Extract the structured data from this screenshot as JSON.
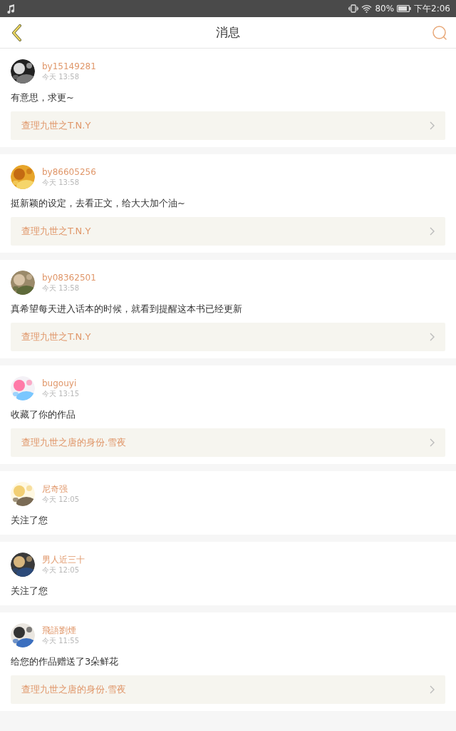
{
  "status_bar": {
    "battery": "80%",
    "time": "下午2:06"
  },
  "header": {
    "title": "消息"
  },
  "messages": [
    {
      "user": "by15149281",
      "time": "今天 13:58",
      "text": "有意思，求更~",
      "link": "查理九世之T.N.Y"
    },
    {
      "user": "by86605256",
      "time": "今天 13:58",
      "text": "挺新颖的设定，去看正文，给大大加个油~",
      "link": "查理九世之T.N.Y"
    },
    {
      "user": "by08362501",
      "time": "今天 13:58",
      "text": "真希望每天进入话本的时候，就看到提醒这本书已经更新",
      "link": "查理九世之T.N.Y"
    },
    {
      "user": "bugouyi",
      "time": "今天 13:15",
      "text": "收藏了你的作品",
      "link": "查理九世之唐的身份.雪夜"
    },
    {
      "user": "尼奇强",
      "time": "今天 12:05",
      "text": "关注了您"
    },
    {
      "user": "男人近三十",
      "time": "今天 12:05",
      "text": "关注了您"
    },
    {
      "user": "飛語劉煙",
      "time": "今天 11:55",
      "text": "给您的作品赠送了3朵鲜花",
      "link": "查理九世之唐的身份.雪夜"
    }
  ]
}
